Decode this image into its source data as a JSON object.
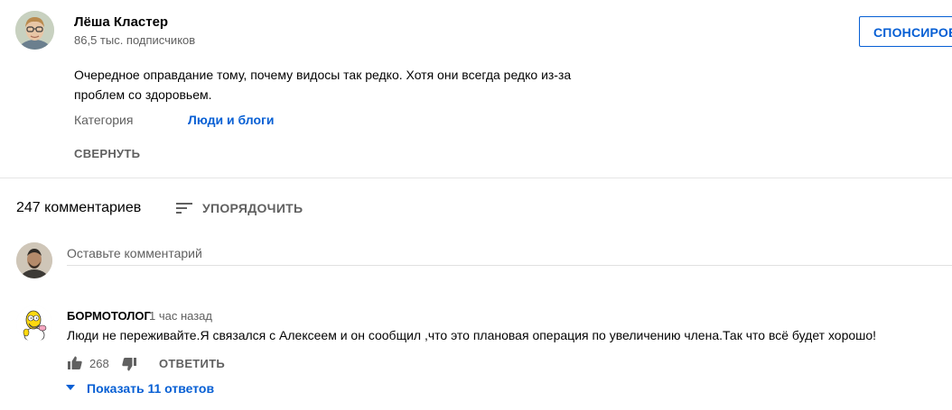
{
  "channel": {
    "name": "Лёша Кластер",
    "subscribers": "86,5 тыс. подписчиков",
    "sponsor_label": "СПОНСИРОВАТЬ"
  },
  "description": {
    "text_line1": "Очередное оправдание тому, почему видосы так редко. Хотя они всегда редко из-за",
    "text_line2": "проблем со здоровьем.",
    "category_label": "Категория",
    "category_value": "Люди и блоги",
    "collapse_label": "СВЕРНУТЬ"
  },
  "comments_header": {
    "count": "247 комментариев",
    "sort_label": "УПОРЯДОЧИТЬ"
  },
  "add_comment": {
    "placeholder": "Оставьте комментарий"
  },
  "comment": {
    "author": "БОРМОТОЛОГ",
    "time": "1 час назад",
    "text": "Люди не переживайте.Я связался с Алексеем и он сообщил ,что это плановая операция по увеличению члена.Так что всё будет хорошо!",
    "likes": "268",
    "reply_label": "ОТВЕТИТЬ",
    "show_replies": "Показать 11 ответов"
  },
  "colors": {
    "accent_blue": "#065fd4",
    "secondary_text": "#606060",
    "divider": "#e5e5e5"
  },
  "icons": [
    "sort-icon",
    "like-icon",
    "dislike-icon",
    "chevron-down-icon"
  ]
}
